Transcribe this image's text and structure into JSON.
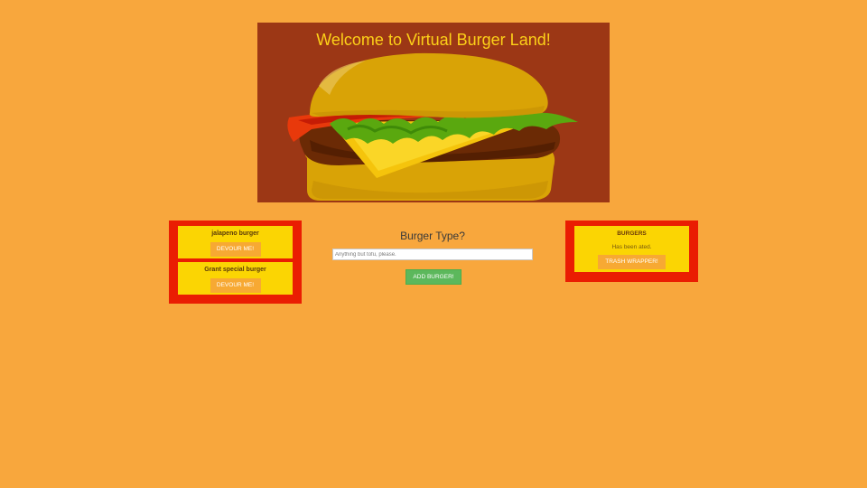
{
  "hero": {
    "title": "Welcome to Virtual Burger Land!",
    "image_icon": "burger-illustration",
    "colors": {
      "background": "#9c3715",
      "title": "#fdd118"
    }
  },
  "uneaten": {
    "burgers": [
      {
        "name": "jalapeno burger",
        "button_label": "DEVOUR ME!"
      },
      {
        "name": "Grant special burger",
        "button_label": "DEVOUR ME!"
      }
    ]
  },
  "form": {
    "title": "Burger Type?",
    "input_placeholder": "Anything but tofu, please.",
    "input_value": "",
    "submit_label": "ADD BURGER!"
  },
  "devoured": {
    "heading": "BURGERS",
    "text": "Has been ated.",
    "button_label": "TRASH WRAPPER!"
  },
  "colors": {
    "page_background": "#f8a73d",
    "panel_red": "#ea1d02",
    "card_yellow": "#fbd503",
    "button_orange": "#f7a933",
    "button_green": "#5cb85c"
  }
}
